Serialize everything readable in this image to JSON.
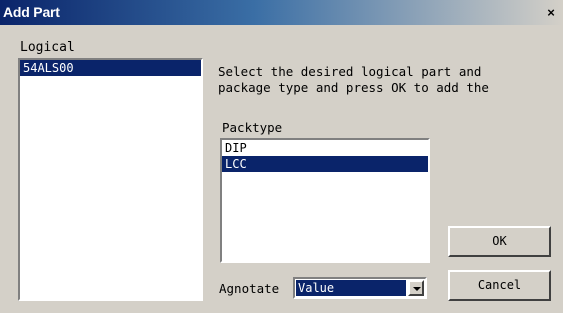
{
  "window": {
    "title": "Add Part",
    "close_glyph": "×",
    "close_icon": "close-icon"
  },
  "logical": {
    "label": "Logical",
    "items": [
      {
        "label": "54ALS00",
        "selected": true
      }
    ]
  },
  "instructions": {
    "line1": "Select the desired logical part and",
    "line2": "package type and press OK to add the"
  },
  "packtype": {
    "label": "Packtype",
    "items": [
      {
        "label": "DIP",
        "selected": false
      },
      {
        "label": "LCC",
        "selected": true
      }
    ]
  },
  "annotate": {
    "label": "Agnotate",
    "value": "Value",
    "arrow_icon": "chevron-down-icon"
  },
  "buttons": {
    "ok": "OK",
    "cancel": "Cancel"
  },
  "colors": {
    "selection": "#0a246a",
    "titlebar_start": "#0a246a",
    "face": "#d4d0c8"
  }
}
